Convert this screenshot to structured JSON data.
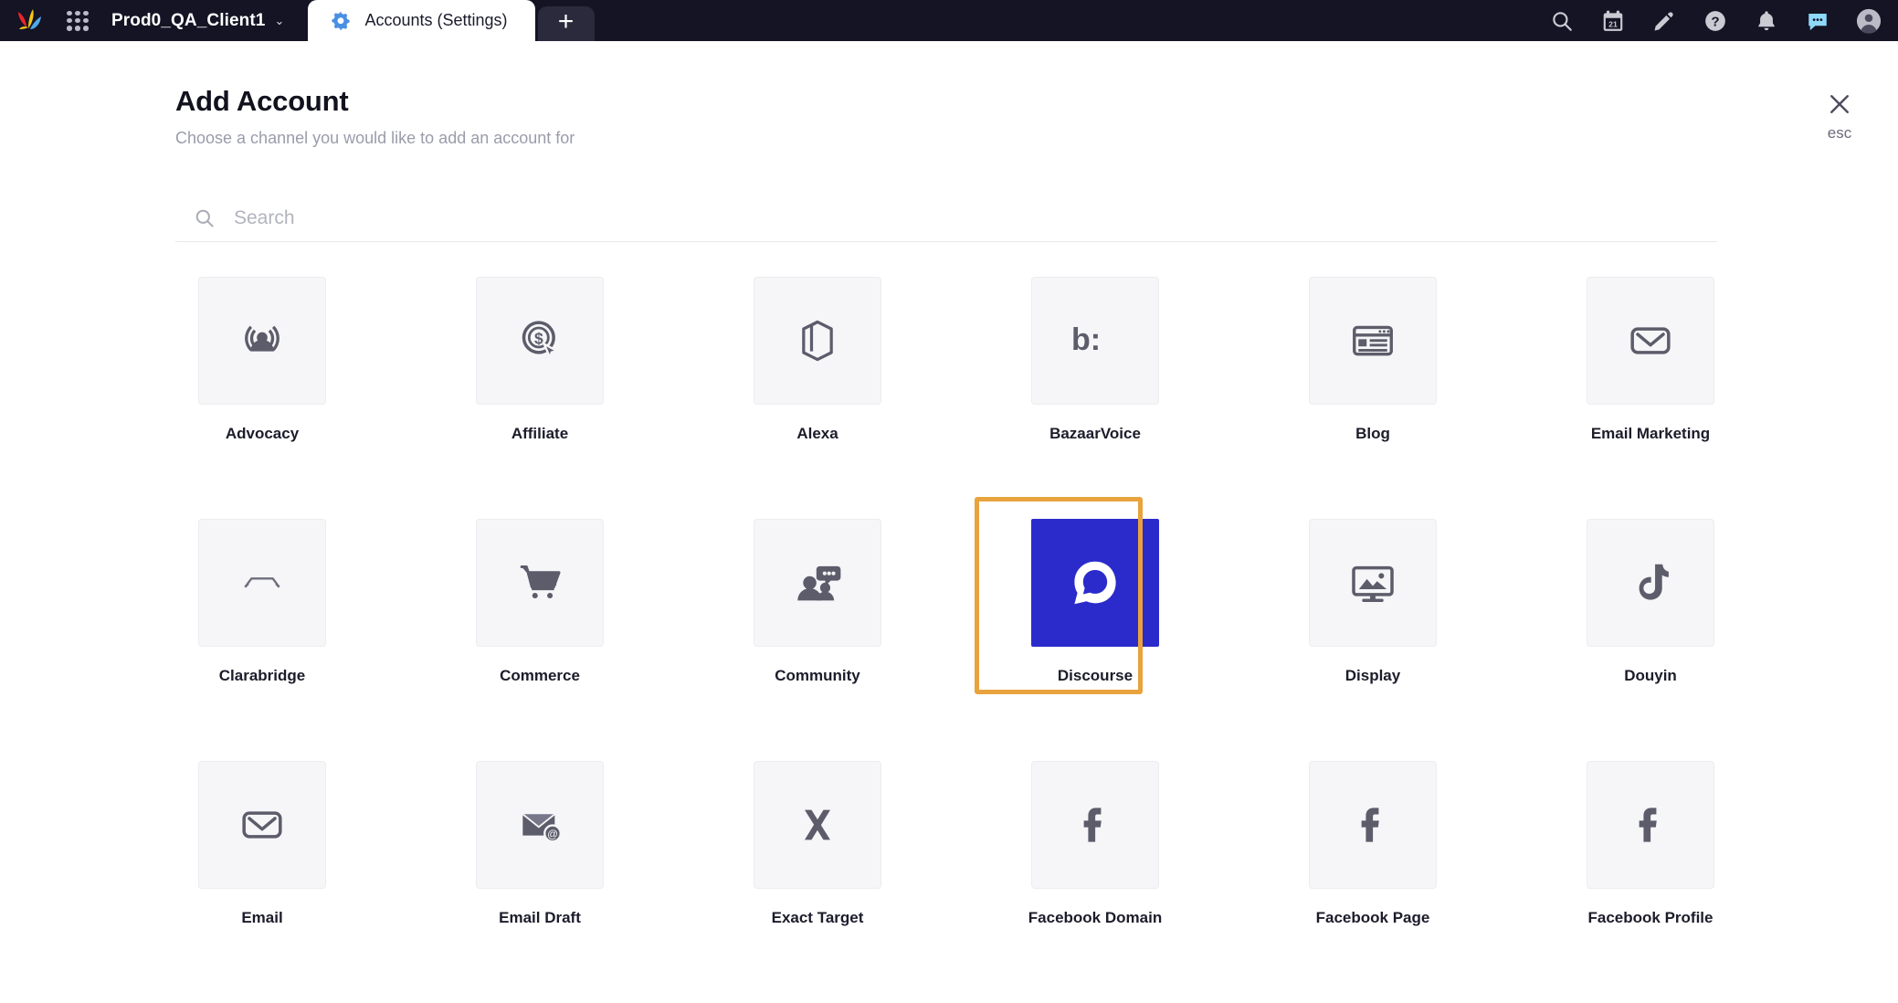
{
  "topbar": {
    "logo_name": "sprinklr-logo",
    "app_grid_name": "app-grid-icon",
    "workspace": "Prod0_QA_Client1",
    "workspace_chevron": "⌄",
    "tab": {
      "label": "Accounts (Settings)",
      "icon": "gear-icon"
    },
    "new_tab_label": "+",
    "icons": [
      {
        "name": "search-icon",
        "title": "Search"
      },
      {
        "name": "calendar-icon",
        "title": "Calendar",
        "day": "21"
      },
      {
        "name": "pencil-icon",
        "title": "Compose"
      },
      {
        "name": "help-icon",
        "title": "Help"
      },
      {
        "name": "bell-icon",
        "title": "Notifications"
      },
      {
        "name": "chat-icon",
        "title": "Messages"
      },
      {
        "name": "avatar-icon",
        "title": "Profile"
      }
    ]
  },
  "page": {
    "title": "Add Account",
    "subtitle": "Choose a channel you would like to add an account for",
    "close_label": "esc"
  },
  "search": {
    "placeholder": "Search",
    "value": ""
  },
  "colors": {
    "topbar_bg": "#141424",
    "tile_bg": "#f6f6f8",
    "selected_tile_bg": "#2B2BCB",
    "selection_ring": "#E8A33D",
    "icon_gray": "#5c5c6b",
    "muted_text": "#9a9cab"
  },
  "channels": [
    {
      "label": "Advocacy",
      "icon": "advocacy-broadcast-icon",
      "selected": false
    },
    {
      "label": "Affiliate",
      "icon": "affiliate-coin-cursor-icon",
      "selected": false
    },
    {
      "label": "Alexa",
      "icon": "alexa-box-icon",
      "selected": false
    },
    {
      "label": "BazaarVoice",
      "icon": "bazaarvoice-logo-icon",
      "selected": false
    },
    {
      "label": "Blog",
      "icon": "blog-window-icon",
      "selected": false
    },
    {
      "label": "Email Marketing",
      "icon": "envelope-outline-icon",
      "selected": false
    },
    {
      "label": "Clarabridge",
      "icon": "clarabridge-bridge-icon",
      "selected": false
    },
    {
      "label": "Commerce",
      "icon": "shopping-cart-icon",
      "selected": false
    },
    {
      "label": "Community",
      "icon": "community-people-icon",
      "selected": false
    },
    {
      "label": "Discourse",
      "icon": "discourse-logo-icon",
      "selected": true
    },
    {
      "label": "Display",
      "icon": "display-monitor-icon",
      "selected": false
    },
    {
      "label": "Douyin",
      "icon": "douyin-note-icon",
      "selected": false
    },
    {
      "label": "Email",
      "icon": "envelope-outline-icon",
      "selected": false
    },
    {
      "label": "Email Draft",
      "icon": "envelope-at-icon",
      "selected": false
    },
    {
      "label": "Exact Target",
      "icon": "exact-target-x-icon",
      "selected": false
    },
    {
      "label": "Facebook Domain",
      "icon": "facebook-f-icon",
      "selected": false
    },
    {
      "label": "Facebook Page",
      "icon": "facebook-f-icon",
      "selected": false
    },
    {
      "label": "Facebook Profile",
      "icon": "facebook-f-icon",
      "selected": false
    }
  ]
}
